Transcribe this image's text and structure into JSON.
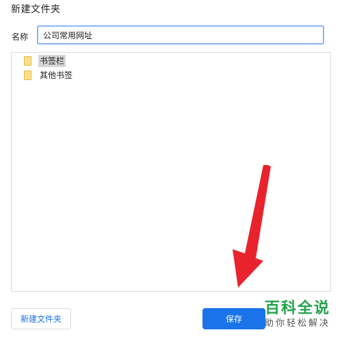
{
  "dialog": {
    "title": "新建文件夹",
    "name_label": "名称",
    "name_value": "公司常用网址"
  },
  "tree": {
    "items": [
      {
        "label": "书签栏",
        "selected": true,
        "icon": "folder-icon"
      },
      {
        "label": "其他书签",
        "selected": false,
        "icon": "folder-icon"
      }
    ]
  },
  "buttons": {
    "new_folder": "新建文件夹",
    "save": "保存"
  },
  "watermark": {
    "title": "百科全说",
    "subtitle": "助你轻松解决"
  },
  "colors": {
    "accent": "#1a73e8",
    "input_focus_border": "#8ab4f8",
    "arrow": "#e8232e",
    "watermark_green": "#1fa34a",
    "folder": "#fbe18b"
  }
}
